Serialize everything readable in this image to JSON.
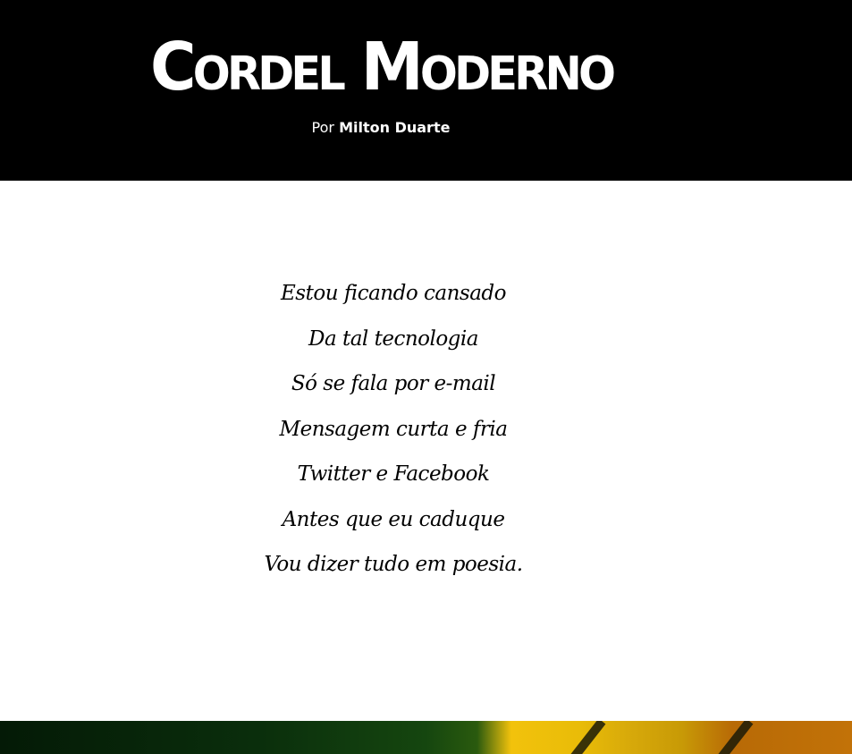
{
  "header": {
    "title": "Cordel Moderno",
    "byline_prefix": "Por",
    "byline_author": "Milton Duarte"
  },
  "poem": {
    "verses": [
      "Estou ficando cansado",
      "Da tal tecnologia",
      "Só se fala por e-mail",
      "Mensagem curta e fria",
      "Twitter e Facebook",
      "Antes que eu caduque",
      "Vou dizer tudo em poesia."
    ]
  },
  "colors": {
    "header_background": "#000000",
    "header_text": "#ffffff",
    "page_background": "#ffffff",
    "poem_text": "#000000",
    "banner_green": "#0a2e0c",
    "banner_yellow": "#f2c20c",
    "banner_orange": "#c27208"
  }
}
